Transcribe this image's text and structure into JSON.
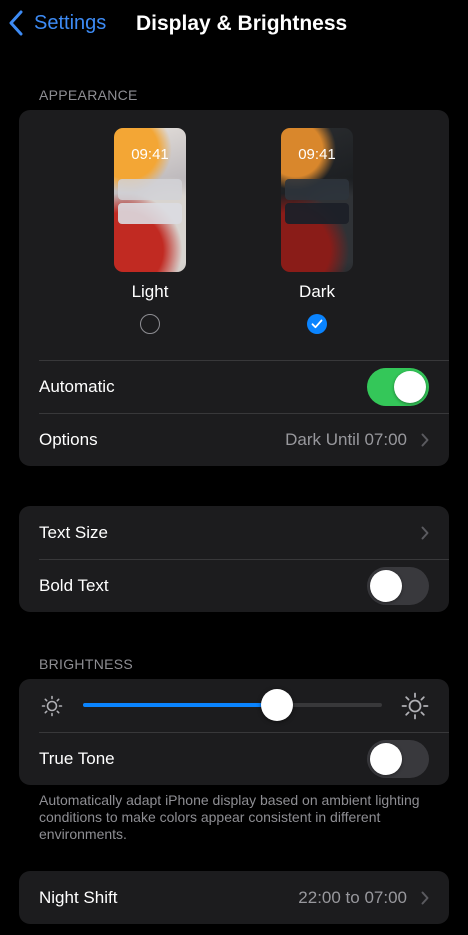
{
  "nav": {
    "back_label": "Settings",
    "title": "Display & Brightness"
  },
  "appearance": {
    "header": "APPEARANCE",
    "light": {
      "time": "09:41",
      "label": "Light",
      "selected": false
    },
    "dark": {
      "time": "09:41",
      "label": "Dark",
      "selected": true
    },
    "automatic": {
      "label": "Automatic",
      "on": true
    },
    "options": {
      "label": "Options",
      "value": "Dark Until 07:00"
    }
  },
  "text": {
    "text_size": {
      "label": "Text Size"
    },
    "bold_text": {
      "label": "Bold Text",
      "on": false
    }
  },
  "brightness": {
    "header": "BRIGHTNESS",
    "level": 0.65,
    "true_tone": {
      "label": "True Tone",
      "on": false
    },
    "footnote": "Automatically adapt iPhone display based on ambient lighting conditions to make colors appear consistent in different environments."
  },
  "night_shift": {
    "label": "Night Shift",
    "value": "22:00 to 07:00"
  },
  "colors": {
    "accent": "#0a84ff",
    "toggle_on": "#34c759",
    "cell": "#1c1c1e"
  },
  "icons": [
    "chevron-left-icon",
    "chevron-right-icon",
    "checkmark-icon",
    "sun-small-icon",
    "sun-large-icon"
  ]
}
